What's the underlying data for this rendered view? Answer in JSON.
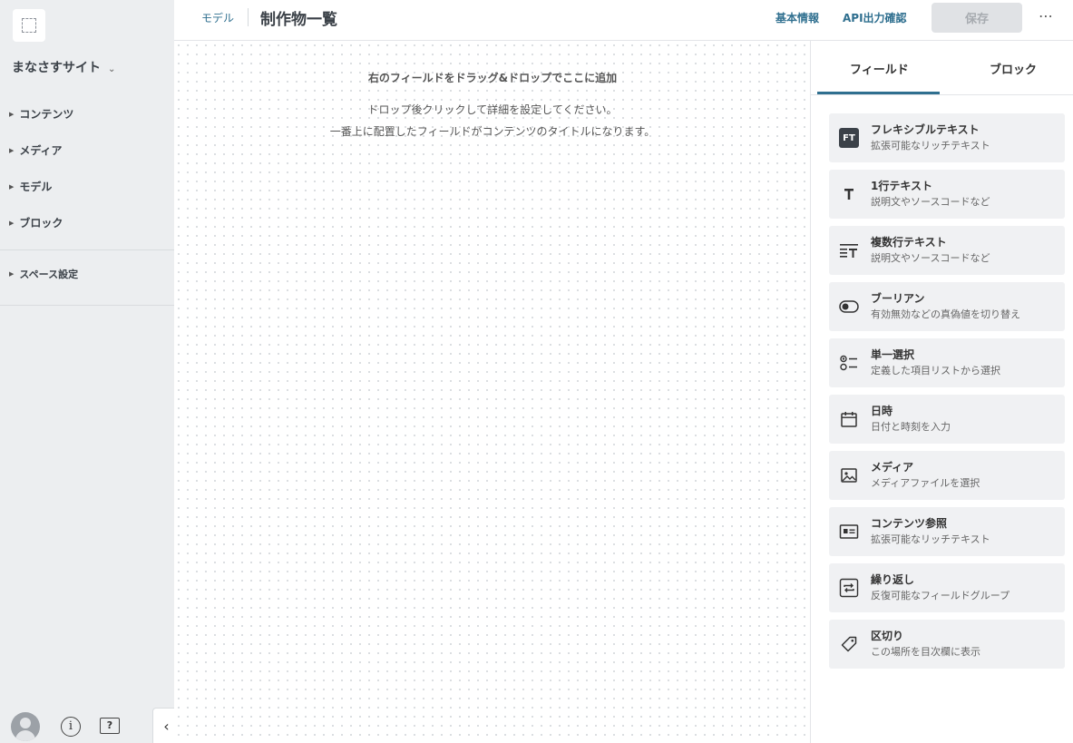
{
  "sidebar": {
    "site_name": "まなさすサイト",
    "items": [
      {
        "label": "コンテンツ"
      },
      {
        "label": "メディア"
      },
      {
        "label": "モデル"
      },
      {
        "label": "ブロック"
      }
    ],
    "settings": {
      "label": "スペース設定"
    }
  },
  "header": {
    "breadcrumb": "モデル",
    "title": "制作物一覧",
    "links": {
      "basic_info": "基本情報",
      "api_output": "API出力確認"
    },
    "save_label": "保存",
    "more_label": "⋯"
  },
  "canvas": {
    "title": "右のフィールドをドラッグ&ドロップでここに追加",
    "line1": "ドロップ後クリックして詳細を設定してください。",
    "line2": "一番上に配置したフィールドがコンテンツのタイトルになります。"
  },
  "panel": {
    "tabs": [
      {
        "label": "フィールド",
        "active": true
      },
      {
        "label": "ブロック",
        "active": false
      }
    ],
    "fields": [
      {
        "icon": "flexible-text-icon",
        "badge": "FT",
        "name": "フレキシブルテキスト",
        "desc": "拡張可能なリッチテキスト"
      },
      {
        "icon": "single-line-text-icon",
        "name": "1行テキスト",
        "desc": "説明文やソースコードなど"
      },
      {
        "icon": "multi-line-text-icon",
        "name": "複数行テキスト",
        "desc": "説明文やソースコードなど"
      },
      {
        "icon": "toggle-icon",
        "name": "ブーリアン",
        "desc": "有効無効などの真偽値を切り替え"
      },
      {
        "icon": "radio-list-icon",
        "name": "単一選択",
        "desc": "定義した項目リストから選択"
      },
      {
        "icon": "calendar-icon",
        "name": "日時",
        "desc": "日付と時刻を入力"
      },
      {
        "icon": "image-icon",
        "name": "メディア",
        "desc": "メディアファイルを選択"
      },
      {
        "icon": "card-icon",
        "name": "コンテンツ参照",
        "desc": "拡張可能なリッチテキスト"
      },
      {
        "icon": "repeat-icon",
        "name": "繰り返し",
        "desc": "反復可能なフィールドグループ"
      },
      {
        "icon": "tag-icon",
        "name": "区切り",
        "desc": "この場所を目次欄に表示"
      }
    ]
  },
  "colors": {
    "accent": "#2f6f8f",
    "sidebar_bg": "#eceef0",
    "field_bg": "#f0f1f3"
  }
}
